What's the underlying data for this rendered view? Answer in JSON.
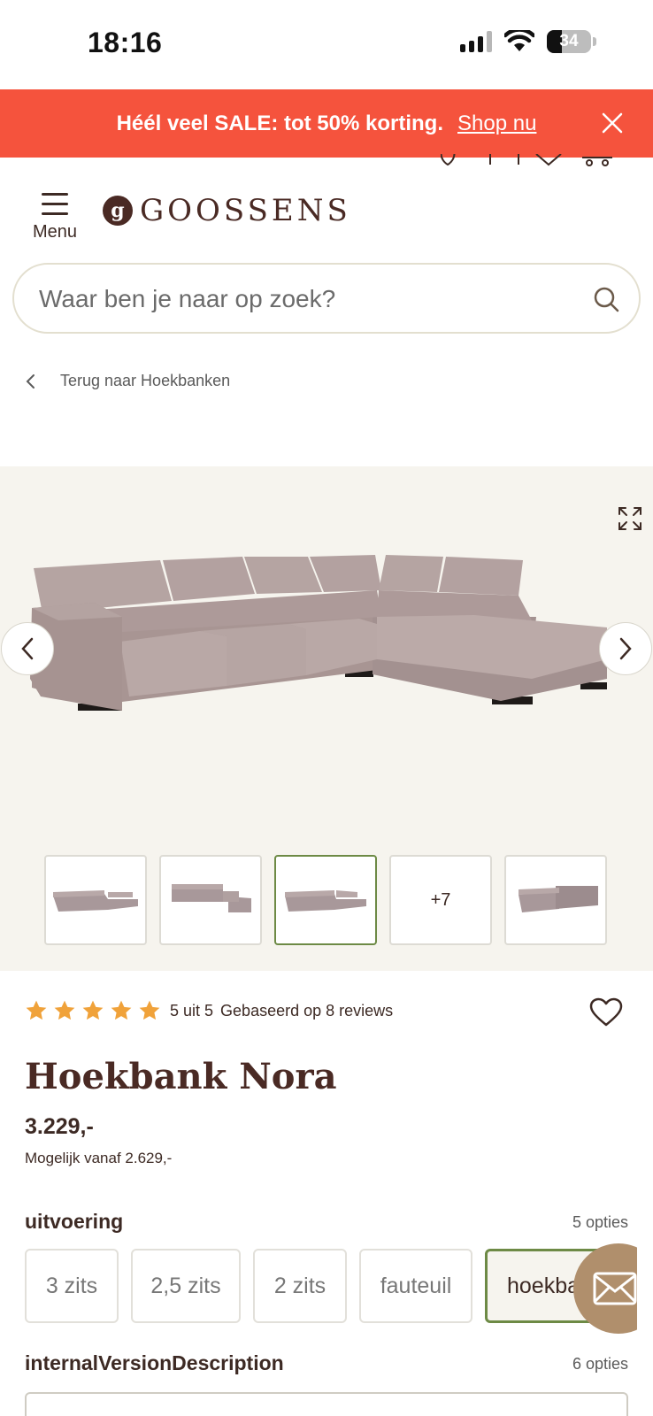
{
  "status_bar": {
    "time": "18:16",
    "battery": "34",
    "battery_level": 0.34
  },
  "promo": {
    "text": "Héél veel SALE: tot 50% korting.",
    "link": "Shop nu"
  },
  "header": {
    "menu_label": "Menu",
    "logo_letter": "g",
    "logo_text": "GOOSSENS"
  },
  "search": {
    "placeholder": "Waar ben je naar op zoek?"
  },
  "breadcrumb": {
    "label": "Terug naar Hoekbanken"
  },
  "gallery": {
    "more_label": "+7",
    "active_thumb": 3
  },
  "product": {
    "rating_value": 5,
    "rating_text": "5 uit 5",
    "reviews_text": "Gebaseerd op 8 reviews",
    "title": "Hoekbank Nora",
    "price": "3.229,-",
    "price_from": "Mogelijk vanaf 2.629,-",
    "option_groups": [
      {
        "label": "uitvoering",
        "count": "5 opties",
        "options": [
          "3 zits",
          "2,5 zits",
          "2 zits",
          "fauteuil",
          "hoekbank"
        ],
        "selected": "hoekbank"
      },
      {
        "label": "internalVersionDescription",
        "count": "6 opties"
      }
    ]
  },
  "colors": {
    "accent_red": "#f5533d",
    "brand_brown": "#4a2a24",
    "star": "#f0a23a",
    "selected_border": "#6d8a45",
    "gallery_bg": "#f6f4ee",
    "fab": "#b08f6c"
  },
  "icons": [
    "close-icon",
    "heart-icon",
    "search-icon",
    "chevron-left-icon",
    "expand-icon",
    "chevron-right-icon",
    "star-icon",
    "mail-icon"
  ]
}
